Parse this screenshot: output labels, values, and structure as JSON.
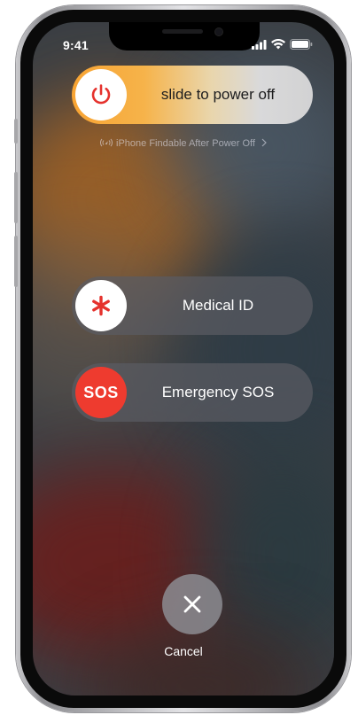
{
  "status_bar": {
    "time": "9:41"
  },
  "power": {
    "label": "slide to power off"
  },
  "findable": {
    "text": "iPhone Findable After Power Off"
  },
  "medical": {
    "label": "Medical ID"
  },
  "sos": {
    "knob_text": "SOS",
    "label": "Emergency SOS"
  },
  "cancel": {
    "label": "Cancel"
  },
  "colors": {
    "accent_orange": "#f8a433",
    "sos_red": "#ee3b2f",
    "power_icon_red": "#e5322d",
    "medical_star_red": "#e5322d"
  }
}
